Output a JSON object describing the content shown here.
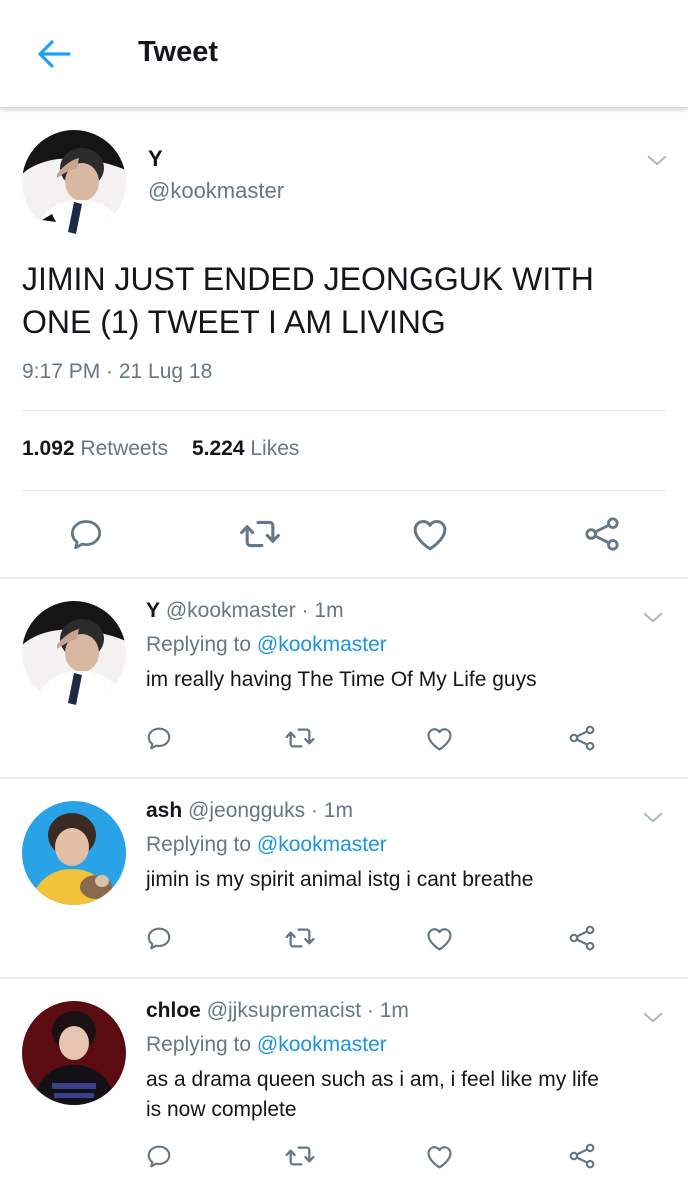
{
  "header": {
    "title": "Tweet"
  },
  "tweet": {
    "name": "Y",
    "handle": "@kookmaster",
    "text": "JIMIN JUST ENDED JEONGGUK WITH ONE (1) TWEET I AM LIVING",
    "time": "9:17 PM · 21 Lug 18",
    "retweets_count": "1.092",
    "retweets_label": "Retweets",
    "likes_count": "5.224",
    "likes_label": "Likes"
  },
  "replies": [
    {
      "name": "Y",
      "handle": "@kookmaster",
      "sep": "·",
      "time": "1m",
      "replying_prefix": "Replying to",
      "replying_to": "@kookmaster",
      "text": "im really having The Time Of My Life guys"
    },
    {
      "name": "ash",
      "handle": "@jeongguks",
      "sep": "·",
      "time": "1m",
      "replying_prefix": "Replying to",
      "replying_to": "@kookmaster",
      "text": "jimin is my spirit animal istg i cant breathe"
    },
    {
      "name": "chloe",
      "handle": "@jjksupremacist",
      "sep": "·",
      "time": "1m",
      "replying_prefix": "Replying to",
      "replying_to": "@kookmaster",
      "text": "as a drama queen such as i am, i feel like my life is now complete"
    }
  ],
  "colors": {
    "accent": "#1da1f2",
    "link": "#1b95e0",
    "secondary_text": "#657786",
    "icon_gray": "#657786"
  },
  "icons": [
    "back-arrow-icon",
    "chevron-down-icon",
    "reply-icon",
    "retweet-icon",
    "like-icon",
    "share-icon"
  ]
}
